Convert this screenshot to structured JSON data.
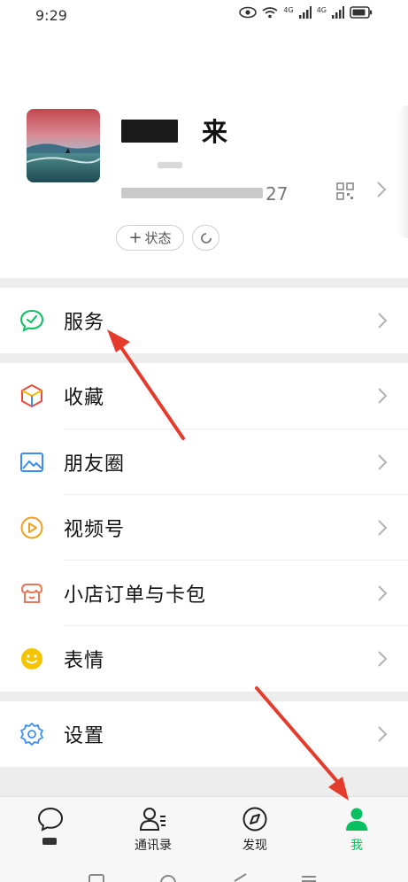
{
  "status_bar": {
    "time": "9:29",
    "network_a": "4G",
    "network_b": "4G"
  },
  "profile": {
    "nickname": "来",
    "wxid_suffix": "27",
    "status_button": "状态"
  },
  "menu": {
    "services": "服务",
    "favorites": "收藏",
    "moments": "朋友圈",
    "channels": "视频号",
    "orders": "小店订单与卡包",
    "stickers": "表情",
    "settings": "设置"
  },
  "tabs": [
    {
      "label": ""
    },
    {
      "label": "通讯录"
    },
    {
      "label": "发现"
    },
    {
      "label": "我"
    }
  ],
  "colors": {
    "accent": "#07c160",
    "annotation_arrow": "#e53b2c",
    "separator": "#ededed"
  }
}
